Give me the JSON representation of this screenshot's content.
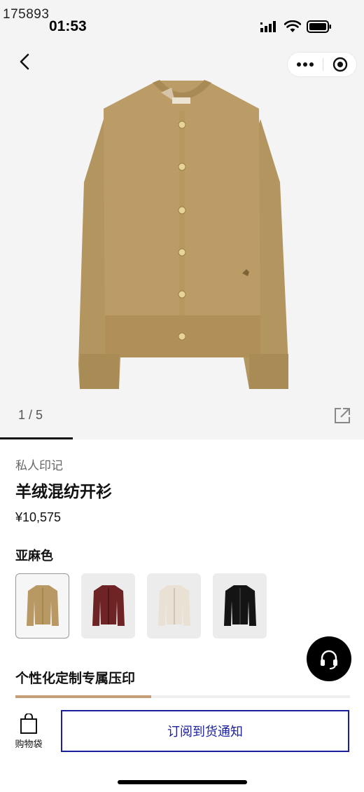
{
  "watermark": "175893",
  "status_bar": {
    "time": "01:53"
  },
  "gallery": {
    "pager": "1 / 5",
    "position": 1,
    "total": 5
  },
  "product": {
    "brand_line": "私人印记",
    "title": "羊绒混纺开衫",
    "price": "¥10,575",
    "color_name": "亚麻色",
    "swatch_colors": [
      "#b89963",
      "#6e2424",
      "#e8e1d4",
      "#141414"
    ]
  },
  "personalization": {
    "title": "个性化定制专属压印"
  },
  "bottom_bar": {
    "bag_label": "购物袋",
    "notify_label": "订阅到货通知"
  },
  "colors": {
    "accent": "#1b1f9c",
    "hero_bg": "#f4f4f4",
    "cardigan": "#b89963"
  },
  "icons": [
    "back-icon",
    "more-icon",
    "target-icon",
    "share-icon",
    "headset-icon",
    "bag-icon"
  ]
}
